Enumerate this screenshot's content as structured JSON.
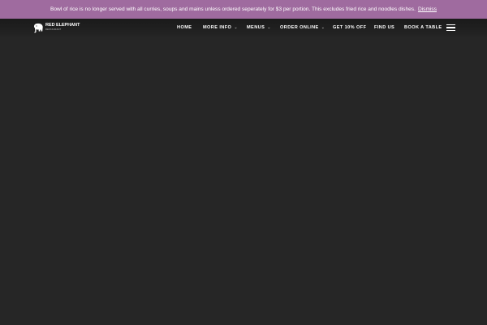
{
  "notice": {
    "text": "Bowl of rice is no longer served with all curries, soups and mains unless ordered seperately for $3 per portion. This excludes fried rice and noodles dishes.",
    "dismiss_label": "Dismiss"
  },
  "brand": {
    "name": "RED ELEPHANT",
    "tagline": "RESTAURANT",
    "logo_icon": "elephant-icon"
  },
  "nav": {
    "home": "HOME",
    "more_info": "MORE INFO",
    "menus": "MENUS",
    "order_online": "ORDER ONLINE",
    "discount": "GET 10% OFF",
    "find_us": "FIND US",
    "book": "BOOK A TABLE",
    "dropdown_icon": "chevron-down-icon",
    "menu_icon": "hamburger-menu-icon"
  },
  "colors": {
    "notice_bar": "#9f6b9f",
    "background": "#262626",
    "text": "#ffffff"
  }
}
